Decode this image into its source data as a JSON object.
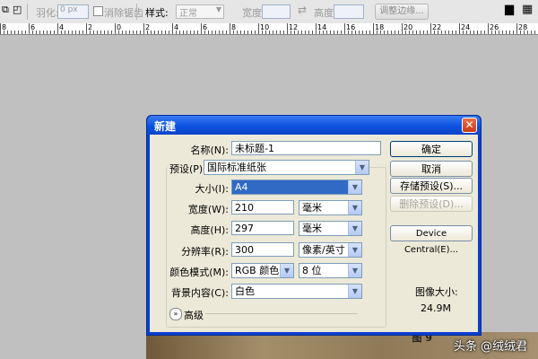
{
  "toolbar": {
    "feather_label": "羽化:",
    "feather_value": "0 px",
    "antialias_label": "消除锯齿",
    "style_label": "样式:",
    "style_value": "正常",
    "width_label": "宽度:",
    "height_label": "高度:",
    "refine_edge_label": "调整边缘..."
  },
  "ruler": {
    "numbers": [
      "8",
      "6",
      "4",
      "2",
      "0",
      "2",
      "4",
      "6",
      "8",
      "10",
      "12",
      "14",
      "16",
      "18",
      "20",
      "22",
      "24",
      "26",
      "28"
    ]
  },
  "dialog": {
    "title": "新建",
    "close_icon": "close-icon",
    "name_label": "名称(N):",
    "name_value": "未标题-1",
    "preset_label": "预设(P):",
    "preset_value": "国际标准纸张",
    "size_label": "大小(I):",
    "size_value": "A4",
    "width_label": "宽度(W):",
    "width_value": "210",
    "width_unit": "毫米",
    "height_label": "高度(H):",
    "height_value": "297",
    "height_unit": "毫米",
    "resolution_label": "分辨率(R):",
    "resolution_value": "300",
    "resolution_unit": "像素/英寸",
    "colormode_label": "颜色模式(M):",
    "colormode_value": "RGB 颜色",
    "bitdepth_value": "8 位",
    "background_label": "背景内容(C):",
    "background_value": "白色",
    "advanced_label": "高级",
    "ok_button": "确定",
    "cancel_button": "取消",
    "save_preset_button": "存储预设(S)...",
    "delete_preset_button": "删除预设(D)...",
    "device_central_button": "Device Central(E)...",
    "image_size_label": "图像大小:",
    "image_size_value": "24.9M"
  },
  "canvas": {
    "figure_tag": "图 9"
  },
  "watermark": "头条 @绒绒君",
  "colors": {
    "dialog_frame": "#0a3fcf",
    "dialog_body": "#ece9d8",
    "selected_field": "#316ac5"
  }
}
